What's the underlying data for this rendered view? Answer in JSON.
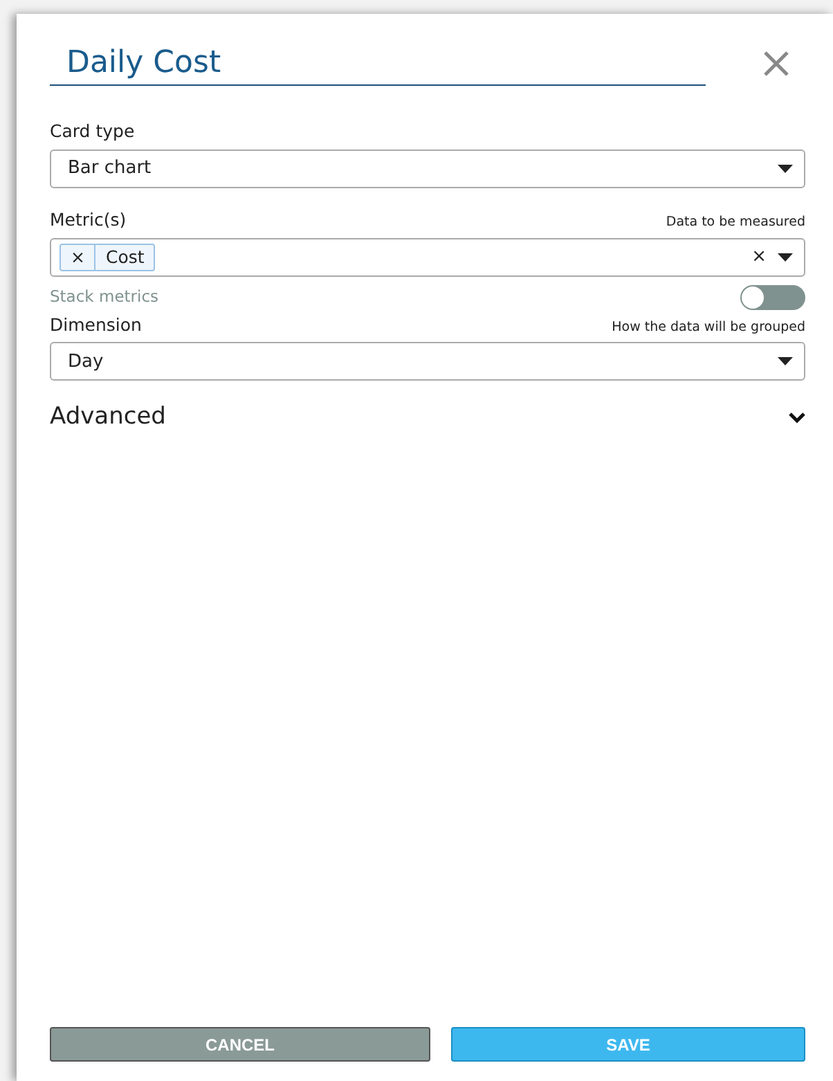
{
  "title_field": {
    "value": "Daily Cost"
  },
  "card_type": {
    "label": "Card type",
    "value": "Bar chart"
  },
  "metrics": {
    "label": "Metric(s)",
    "hint": "Data to be measured",
    "tags": [
      {
        "remove": "×",
        "label": "Cost"
      }
    ],
    "clear": "×"
  },
  "stack_metrics": {
    "label": "Stack metrics",
    "on": false,
    "disabled": true
  },
  "dimension": {
    "label": "Dimension",
    "hint": "How the data will be grouped",
    "value": "Day"
  },
  "advanced": {
    "label": "Advanced",
    "expanded": false
  },
  "buttons": [
    {
      "label": "CANCEL",
      "kind": "cancel"
    },
    {
      "label": "SAVE",
      "kind": "save"
    }
  ]
}
